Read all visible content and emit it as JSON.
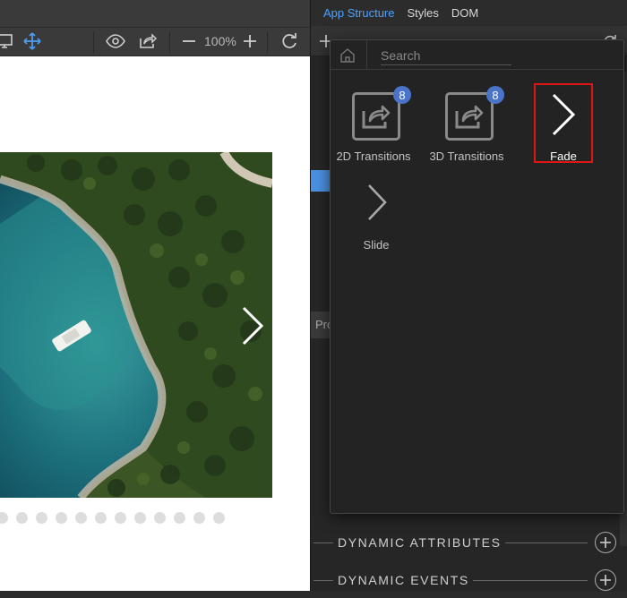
{
  "toolbar": {
    "zoom": "100%"
  },
  "slider": {
    "dot_count": 12
  },
  "right_panel": {
    "tabs": [
      "App Structure",
      "Styles",
      "DOM"
    ],
    "active_tab": "App Structure",
    "props_tab": "Pro",
    "sections": [
      {
        "label": "DYNAMIC ATTRIBUTES"
      },
      {
        "label": "DYNAMIC EVENTS"
      }
    ]
  },
  "popup": {
    "search": {
      "placeholder": "Search",
      "value": ""
    },
    "items": [
      {
        "label": "2D Transitions",
        "badge": "8",
        "icon": "share-icon"
      },
      {
        "label": "3D Transitions",
        "badge": "8",
        "icon": "share-icon"
      },
      {
        "label": "Fade",
        "icon": "chevron-right-icon",
        "selected": true
      },
      {
        "label": "Slide",
        "icon": "chevron-right-icon"
      }
    ]
  },
  "colors": {
    "accent": "#4aa3ff",
    "badge": "#4a74c9",
    "selection": "#e01515",
    "panel_bg": "#262626"
  }
}
